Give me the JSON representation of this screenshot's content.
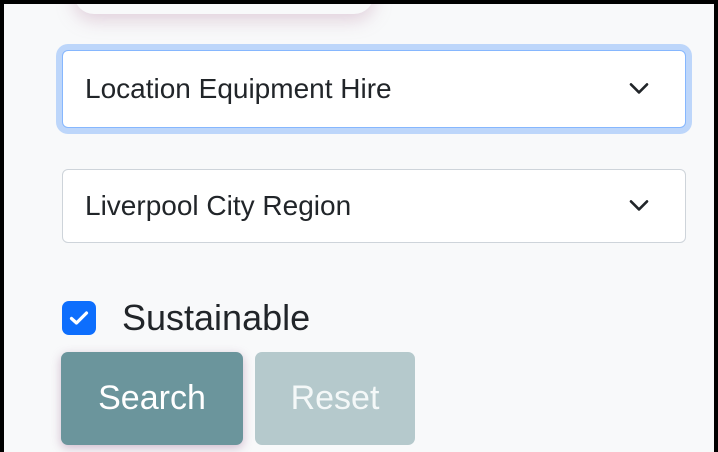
{
  "filters": {
    "category_select": {
      "value": "Location Equipment Hire",
      "focused": true
    },
    "region_select": {
      "value": "Liverpool City Region"
    },
    "sustainable_checkbox": {
      "label": "Sustainable",
      "checked": true
    }
  },
  "actions": {
    "search_label": "Search",
    "reset_label": "Reset"
  },
  "colors": {
    "accent": "#0d6efd",
    "search_button": "#6b959c",
    "reset_button": "#b5c9cc"
  },
  "icons": {
    "dropdown": "chevron-down-icon",
    "check": "check-icon"
  }
}
